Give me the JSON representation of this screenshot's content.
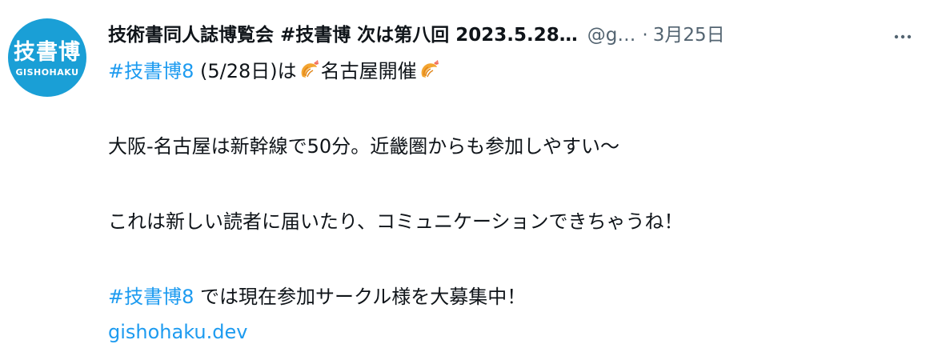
{
  "tweet": {
    "avatar": {
      "main": "技書博",
      "sub": "GISHOHAKU"
    },
    "display_name": "技術書同人誌博覧会 #技書博 次は第八回 2023.5.28…",
    "handle": "@g…",
    "dot": "·",
    "date": "3月25日",
    "more_icon": "more-horizontal-icon",
    "lines": [
      {
        "hashtag": "#技書博8",
        "text1": " (5/28日)は",
        "emoji": "fried-shrimp-emoji",
        "text2": "名古屋開催"
      },
      {
        "text": "大阪-名古屋は新幹線で50分。近畿圏からも参加しやすい〜"
      },
      {
        "text": "これは新しい読者に届いたり、コミュニケーションできちゃうね！"
      },
      {
        "hashtag": "#技書博8",
        "text": " では現在参加サークル様を大募集中！"
      },
      {
        "link": "gishohaku.dev"
      }
    ]
  }
}
